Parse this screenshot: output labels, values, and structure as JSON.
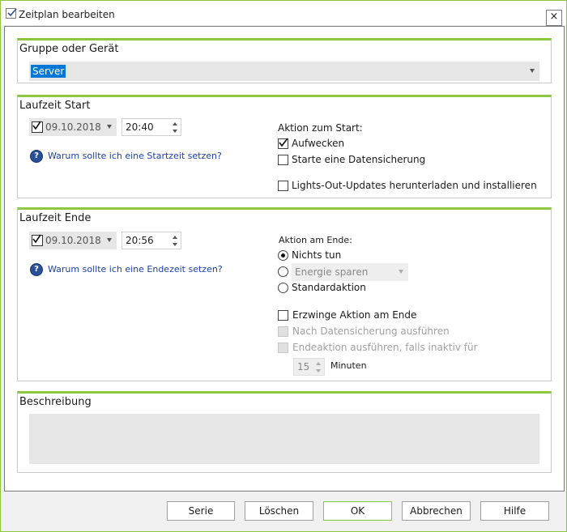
{
  "window": {
    "title": "Zeitplan bearbeiten",
    "close_symbol": "×"
  },
  "group_device": {
    "title": "Gruppe oder Gerät",
    "selected": "Server"
  },
  "start": {
    "title": "Laufzeit Start",
    "date": "09.10.2018",
    "date_checked": true,
    "time": "20:40",
    "help_text": "Warum sollte ich eine Startzeit setzen?",
    "action_title": "Aktion zum Start:",
    "actions": [
      {
        "label": "Aufwecken",
        "checked": true
      },
      {
        "label": "Starte eine Datensicherung",
        "checked": false
      },
      {
        "label": "Lights-Out-Updates herunterladen und installieren",
        "checked": false
      }
    ]
  },
  "end": {
    "title": "Laufzeit Ende",
    "date": "09.10.2018",
    "date_checked": true,
    "time": "20:56",
    "help_text": "Warum sollte ich eine Endezeit setzen?",
    "action_title": "Aktion am Ende:",
    "radio_nothing": "Nichts tun",
    "energy_select": "Energie sparen",
    "radio_default": "Standardaktion",
    "force_label": "Erzwinge Aktion am Ende",
    "after_backup_label": "Nach Datensicherung ausführen",
    "inactive_label": "Endeaktion ausführen, falls inaktiv für",
    "minutes_value": "15",
    "minutes_label": "Minuten"
  },
  "description": {
    "title": "Beschreibung"
  },
  "buttons": {
    "serie": "Serie",
    "delete": "Löschen",
    "ok": "OK",
    "cancel": "Abbrechen",
    "help": "Hilfe"
  },
  "colors": {
    "accent": "#8dc63f",
    "link": "#1a3faa",
    "selection": "#0078d7"
  }
}
